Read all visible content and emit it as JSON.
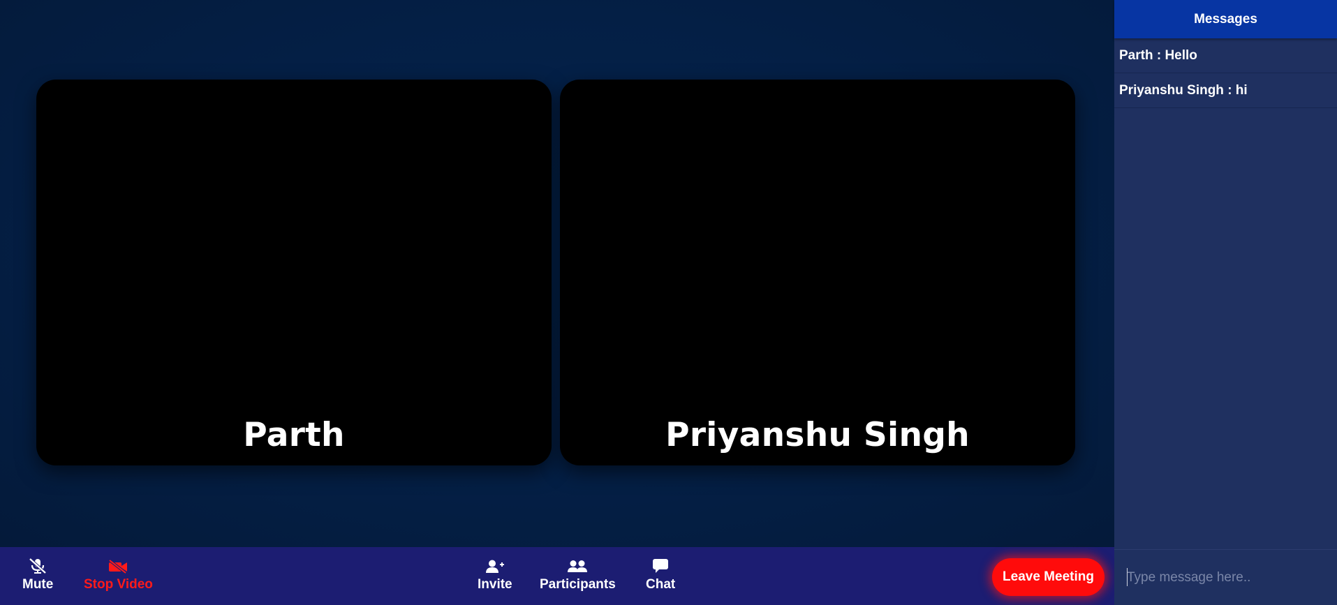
{
  "participants": [
    {
      "name": "Parth"
    },
    {
      "name": "Priyanshu Singh"
    }
  ],
  "toolbar": {
    "mute_label": "Mute",
    "stop_video_label": "Stop Video",
    "invite_label": "Invite",
    "participants_label": "Participants",
    "chat_label": "Chat",
    "leave_label": "Leave Meeting"
  },
  "chat": {
    "title": "Messages",
    "messages": [
      {
        "text": "Parth : Hello"
      },
      {
        "text": "Priyanshu Singh : hi"
      }
    ],
    "input_placeholder": "Type message here.."
  },
  "icons": {
    "mute": "microphone-slash-icon",
    "stop_video": "video-slash-icon",
    "invite": "user-plus-icon",
    "participants": "users-icon",
    "chat": "comment-icon"
  },
  "colors": {
    "background": "#031f47",
    "toolbar": "#1c1d72",
    "panel": "#1f3060",
    "panel_header": "#0735a3",
    "leave_button": "#ff0b0b",
    "stop_video": "#ff1a1a"
  }
}
